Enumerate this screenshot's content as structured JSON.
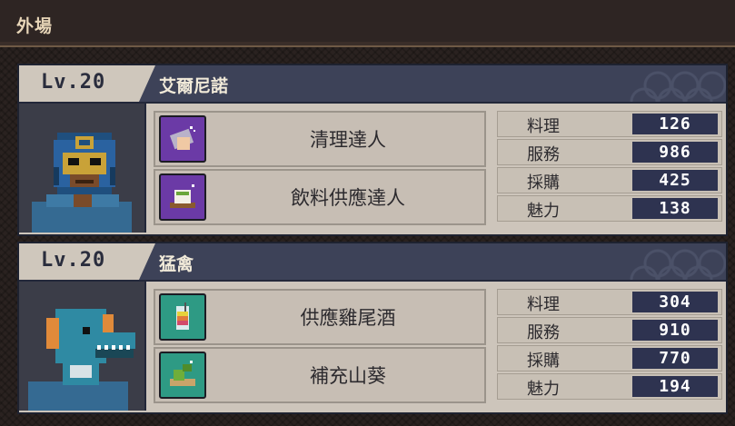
{
  "header": {
    "title": "外場"
  },
  "staff": [
    {
      "level": "Lv.20",
      "name": "艾爾尼諾",
      "skills": [
        {
          "label": "清理達人",
          "icon": "cleaning-icon"
        },
        {
          "label": "飲料供應達人",
          "icon": "drink-icon"
        }
      ],
      "stats": [
        {
          "label": "料理",
          "value": "126"
        },
        {
          "label": "服務",
          "value": "986"
        },
        {
          "label": "採購",
          "value": "425"
        },
        {
          "label": "魅力",
          "value": "138"
        }
      ]
    },
    {
      "level": "Lv.20",
      "name": "猛禽",
      "skills": [
        {
          "label": "供應雞尾酒",
          "icon": "cocktail-icon"
        },
        {
          "label": "補充山葵",
          "icon": "wasabi-icon"
        }
      ],
      "stats": [
        {
          "label": "料理",
          "value": "304"
        },
        {
          "label": "服務",
          "value": "910"
        },
        {
          "label": "採購",
          "value": "770"
        },
        {
          "label": "魅力",
          "value": "194"
        }
      ]
    }
  ],
  "colors": {
    "header_bar": "#3d4258",
    "value_box": "#2e3350",
    "skill_purple": "#6b3aa6",
    "skill_teal": "#2e9a84"
  }
}
